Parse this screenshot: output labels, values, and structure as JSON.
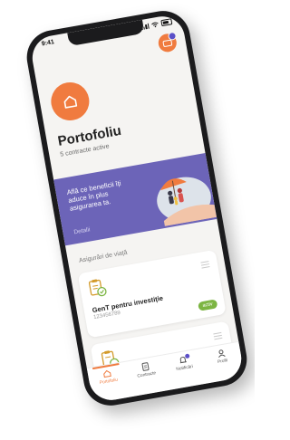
{
  "status_bar": {
    "time": "9:41"
  },
  "header": {
    "title": "Portofoliu",
    "subtitle": "5 contracte active"
  },
  "banner": {
    "text": "Află ce beneficii îți aduce în plus asigurarea ta.",
    "link": "Detalii"
  },
  "section": {
    "label": "Asigurări de viață"
  },
  "policy": {
    "name": "GenT pentru investiție",
    "number": "123456789",
    "status": "activ"
  },
  "tabbar": {
    "items": [
      {
        "label": "Portofoliu",
        "icon": "home-icon"
      },
      {
        "label": "Contracte",
        "icon": "document-icon"
      },
      {
        "label": "Notificări",
        "icon": "bell-icon"
      },
      {
        "label": "Profil",
        "icon": "user-icon"
      }
    ]
  },
  "colors": {
    "accent": "#f07b3f",
    "banner": "#6c64b8",
    "status_active": "#7cb542",
    "notification": "#5b4fc7"
  }
}
